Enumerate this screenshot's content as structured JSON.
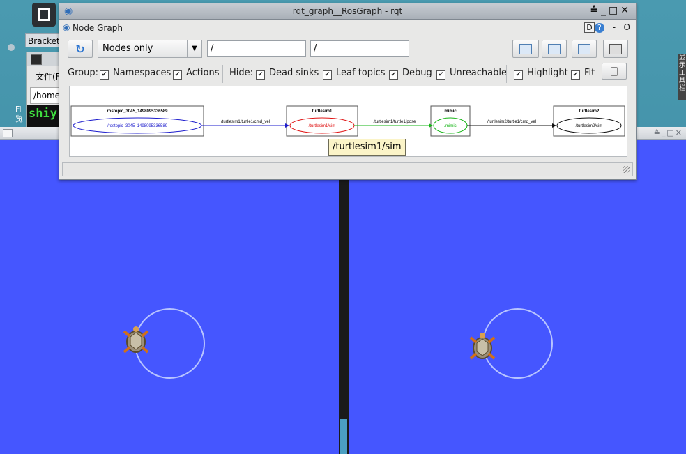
{
  "desktop": {
    "brackets_label": "Brackets",
    "terminal_menu": "文件(F",
    "terminal_path": "/home",
    "terminal_prompt": "shiy",
    "left_side_text": "Fi 览",
    "right_side_text": "显示工具栏"
  },
  "rqt": {
    "title": "rqt_graph__RosGraph - rqt",
    "window_controls": "≙_□✕",
    "plugin_label": "Node Graph",
    "plugin_d": "D",
    "plugin_help": "?",
    "plugin_dash": "-",
    "plugin_zero": "O",
    "toolbar": {
      "refresh_icon": "refresh-icon",
      "combo_value": "Nodes only",
      "combo_arrow": "▼",
      "ns_filter_value": "/",
      "topic_filter_value": "/"
    },
    "options": {
      "group_label": "Group:",
      "namespaces_label": "Namespaces",
      "actions_label": "Actions",
      "hide_label": "Hide:",
      "dead_sinks_label": "Dead sinks",
      "leaf_topics_label": "Leaf topics",
      "debug_label": "Debug",
      "unreachable_label": "Unreachable",
      "highlight_label": "Highlight",
      "fit_label": "Fit",
      "check_mark": "✔"
    },
    "graph": {
      "nodes": [
        {
          "box_label": "rostopic_3045_1498095336589",
          "ellipse_label": "/rostopic_3045_1498095336589",
          "color": "#1d1dcc"
        },
        {
          "box_label": "turtlesim1",
          "ellipse_label": "/turtlesim1/sim",
          "color": "#e01515"
        },
        {
          "box_label": "mimic",
          "ellipse_label": "/mimic",
          "color": "#16b516"
        },
        {
          "box_label": "turtlesim2",
          "ellipse_label": "/turtlesim2/sim",
          "color": "#111111"
        }
      ],
      "edges": [
        {
          "label": "/turtlesim1/turtle1/cmd_vel",
          "color": "#1d1dcc"
        },
        {
          "label": "/turtlesim1/turtle1/pose",
          "color": "#16b516"
        },
        {
          "label": "/turtlesim2/turtle1/cmd_vel",
          "color": "#111111"
        }
      ]
    },
    "tooltip": "/turtlesim1/sim"
  },
  "turtlesim": {
    "background_color": "#4556ff",
    "trail_color": "#b8c4ff",
    "right_window_controls": "≙_□✕"
  }
}
